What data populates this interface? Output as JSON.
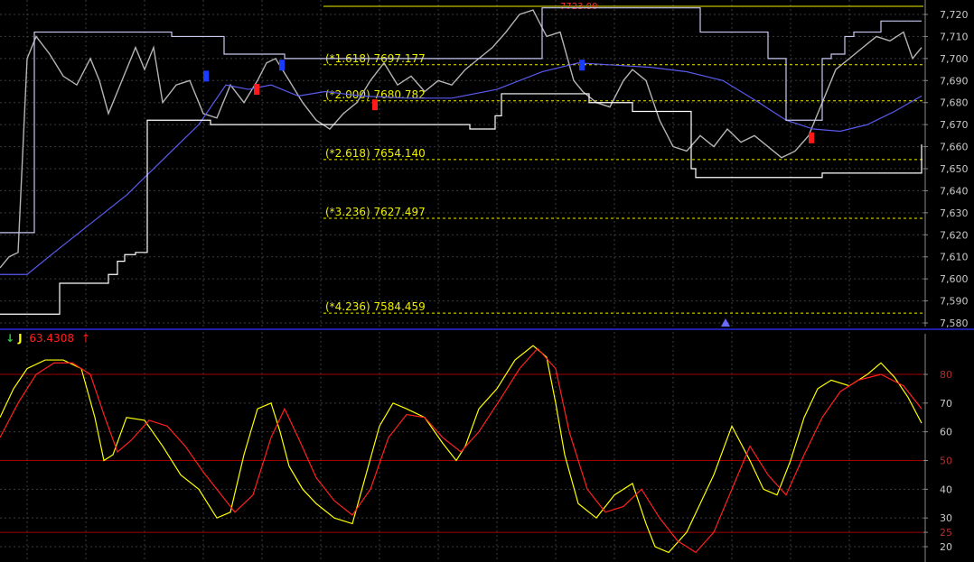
{
  "chart_data": [
    {
      "type": "line",
      "panel": "price",
      "ylim": [
        7580,
        7720
      ],
      "y_ticks": [
        "7,720",
        "7,710",
        "7,700",
        "7,690",
        "7,680",
        "7,670",
        "7,660",
        "7,650",
        "7,640",
        "7,630",
        "7,620",
        "7,610",
        "7,600",
        "7,590",
        "7,580"
      ],
      "top_marker_label": "7723.00",
      "fib_levels": [
        {
          "label": "(*1.618) 7697.177",
          "value": 7697.177
        },
        {
          "label": "(*2.000) 7680.782",
          "value": 7680.782
        },
        {
          "label": "(*2.618) 7654.140",
          "value": 7654.14
        },
        {
          "label": "(*3.236) 7627.497",
          "value": 7627.497
        },
        {
          "label": "(*4.236) 7584.459",
          "value": 7584.459
        }
      ],
      "series": [
        {
          "key": "price",
          "color": "#b4b4b4",
          "x": [
            0,
            10,
            20,
            30,
            40,
            55,
            70,
            85,
            100,
            110,
            120,
            135,
            150,
            160,
            170,
            180,
            195,
            210,
            225,
            240,
            255,
            270,
            285,
            295,
            305,
            320,
            335,
            350,
            365,
            380,
            395,
            410,
            425,
            440,
            455,
            470,
            485,
            500,
            515,
            530,
            545,
            560,
            575,
            590,
            605,
            620,
            635,
            645,
            660,
            675,
            690,
            700,
            715,
            730,
            745,
            760,
            775,
            790,
            805,
            820,
            835,
            850,
            865,
            880,
            895,
            910,
            925,
            940,
            955,
            970,
            985,
            1000,
            1010,
            1020
          ],
          "y": [
            7605,
            7610,
            7612,
            7700,
            7710,
            7702,
            7692,
            7688,
            7700,
            7690,
            7675,
            7690,
            7705,
            7695,
            7705,
            7680,
            7688,
            7690,
            7675,
            7673,
            7688,
            7680,
            7690,
            7698,
            7700,
            7690,
            7680,
            7672,
            7668,
            7675,
            7680,
            7690,
            7698,
            7688,
            7692,
            7685,
            7690,
            7688,
            7695,
            7700,
            7705,
            7712,
            7720,
            7722,
            7710,
            7712,
            7690,
            7685,
            7680,
            7678,
            7690,
            7695,
            7690,
            7672,
            7660,
            7658,
            7665,
            7660,
            7668,
            7662,
            7665,
            7660,
            7655,
            7658,
            7665,
            7680,
            7695,
            7700,
            7705,
            7710,
            7708,
            7712,
            7700,
            7705
          ]
        },
        {
          "key": "moving-average",
          "color": "#5a5af0",
          "x": [
            0,
            30,
            60,
            100,
            140,
            165,
            190,
            220,
            250,
            275,
            300,
            330,
            360,
            400,
            450,
            500,
            550,
            600,
            640,
            680,
            720,
            760,
            800,
            840,
            870,
            900,
            930,
            960,
            990,
            1020
          ],
          "y": [
            7602,
            7602,
            7612,
            7625,
            7638,
            7648,
            7658,
            7670,
            7688,
            7686,
            7688,
            7683,
            7685,
            7683,
            7682,
            7682,
            7686,
            7694,
            7698,
            7697,
            7696,
            7694,
            7690,
            7680,
            7672,
            7668,
            7667,
            7670,
            7676,
            7683
          ]
        },
        {
          "key": "upper-channel",
          "color": "#c8c8f0",
          "step": true,
          "x": [
            0,
            28,
            38,
            180,
            190,
            248,
            300,
            315,
            460,
            555,
            600,
            745,
            775,
            850,
            870,
            900,
            910,
            920,
            935,
            945,
            975,
            1020
          ],
          "y": [
            7621,
            7621,
            7712,
            7712,
            7710,
            7702,
            7702,
            7700,
            7700,
            7700,
            7723,
            7723,
            7712,
            7700,
            7672,
            7672,
            7700,
            7702,
            7710,
            7712,
            7717,
            7717
          ]
        },
        {
          "key": "lower-channel",
          "color": "#ffffff",
          "step": true,
          "x": [
            0,
            62,
            66,
            115,
            120,
            130,
            138,
            150,
            163,
            233,
            362,
            520,
            548,
            555,
            646,
            652,
            700,
            730,
            765,
            770,
            905,
            910,
            1010,
            1020
          ],
          "y": [
            7584,
            7584,
            7598,
            7598,
            7602,
            7608,
            7611,
            7612,
            7672,
            7670,
            7670,
            7668,
            7674,
            7684,
            7684,
            7680,
            7676,
            7676,
            7650,
            7646,
            7646,
            7648,
            7648,
            7661
          ]
        }
      ],
      "markers": [
        {
          "kind": "sell",
          "x": 228,
          "y": 7692
        },
        {
          "kind": "sell",
          "x": 312,
          "y": 7697
        },
        {
          "kind": "sell",
          "x": 644,
          "y": 7697
        },
        {
          "kind": "buy",
          "x": 284,
          "y": 7686
        },
        {
          "kind": "buy",
          "x": 415,
          "y": 7679
        },
        {
          "kind": "buy",
          "x": 898,
          "y": 7664
        }
      ],
      "bottom_triangle_x": 803,
      "colors": {
        "fib": "#f0f000",
        "grid": "#3c3c3c",
        "axis_text": "#c8c8c8",
        "sell_marker": "#1a3cff",
        "buy_marker": "#ff1a1a",
        "triangle": "#6a6aff",
        "separator": "#1e1ea8",
        "top_marker_text": "#ff3030"
      }
    },
    {
      "type": "line",
      "panel": "oscillator",
      "ylim": [
        17,
        95
      ],
      "y_ticks": [
        "80",
        "70",
        "60",
        "50",
        "40",
        "30",
        "25",
        "20"
      ],
      "ref_lines": [
        80,
        50,
        25
      ],
      "ref_line_labels": [
        "80",
        "50",
        "25"
      ],
      "indicator": {
        "name": "J",
        "value": "63.4308"
      },
      "series": [
        {
          "key": "fast",
          "color": "#ffff00",
          "x": [
            0,
            15,
            30,
            50,
            70,
            90,
            105,
            115,
            125,
            140,
            160,
            180,
            200,
            220,
            240,
            255,
            270,
            285,
            300,
            310,
            320,
            335,
            350,
            370,
            390,
            405,
            420,
            435,
            450,
            470,
            490,
            505,
            515,
            530,
            550,
            570,
            590,
            605,
            615,
            625,
            640,
            660,
            680,
            700,
            715,
            725,
            740,
            760,
            775,
            790,
            810,
            830,
            845,
            860,
            875,
            890,
            905,
            920,
            940,
            960,
            975,
            990,
            1005,
            1020
          ],
          "y": [
            65,
            75,
            82,
            85,
            85,
            82,
            65,
            50,
            52,
            65,
            64,
            55,
            45,
            40,
            30,
            32,
            52,
            68,
            70,
            60,
            48,
            40,
            35,
            30,
            28,
            45,
            62,
            70,
            68,
            65,
            56,
            50,
            55,
            68,
            75,
            85,
            90,
            86,
            70,
            52,
            35,
            30,
            38,
            42,
            28,
            20,
            18,
            25,
            35,
            45,
            62,
            50,
            40,
            38,
            50,
            65,
            75,
            78,
            76,
            80,
            84,
            79,
            72,
            63
          ]
        },
        {
          "key": "slow",
          "color": "#ff2020",
          "x": [
            0,
            20,
            40,
            60,
            80,
            100,
            115,
            130,
            145,
            165,
            185,
            205,
            225,
            245,
            260,
            280,
            300,
            315,
            330,
            350,
            370,
            390,
            410,
            430,
            450,
            470,
            490,
            510,
            530,
            555,
            575,
            595,
            615,
            630,
            650,
            670,
            690,
            710,
            730,
            750,
            770,
            790,
            810,
            830,
            850,
            870,
            890,
            910,
            930,
            950,
            975,
            1000,
            1020
          ],
          "y": [
            58,
            70,
            80,
            84,
            84,
            80,
            66,
            53,
            57,
            64,
            62,
            55,
            46,
            38,
            32,
            38,
            58,
            68,
            58,
            44,
            36,
            31,
            40,
            58,
            66,
            65,
            58,
            53,
            60,
            72,
            82,
            89,
            82,
            60,
            40,
            32,
            34,
            40,
            30,
            22,
            18,
            25,
            40,
            55,
            45,
            38,
            52,
            65,
            74,
            78,
            80,
            76,
            68
          ]
        }
      ],
      "colors": {
        "ref": "#a00000",
        "ref_label": "#b03030",
        "grid": "#3c3c3c",
        "axis_text": "#c8c8c8"
      }
    }
  ],
  "header": {
    "down_arrow": "↓",
    "up_arrow": "↑"
  }
}
